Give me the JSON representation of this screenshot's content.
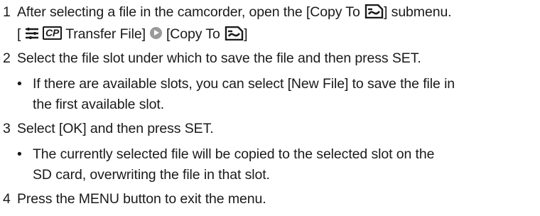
{
  "steps": [
    {
      "number": "1",
      "text_before": "After selecting a file in the camcorder, open the [Copy To ",
      "text_after": "] submenu.",
      "menu_path": {
        "open_bracket": "[",
        "cp_label": "CP",
        "item": " Transfer File]",
        "target_before": "[Copy To ",
        "target_after": "]"
      }
    },
    {
      "number": "2",
      "text": "Select the file slot under which to save the file and then press SET.",
      "bullet": "•",
      "note_line1": "If there are available slots, you can select [New File] to save the file in",
      "note_line2": "the first available slot."
    },
    {
      "number": "3",
      "text": "Select [OK] and then press SET.",
      "bullet": "•",
      "note_line1": "The currently selected file will be copied to the selected slot on the",
      "note_line2": "SD card, overwriting the file in that slot."
    },
    {
      "number": "4",
      "text": "Press the MENU button to exit the menu."
    }
  ],
  "icons": {
    "sd_card": "sd-card-icon",
    "menu": "menu-icon",
    "arrow": "right-arrow-circle-icon"
  }
}
